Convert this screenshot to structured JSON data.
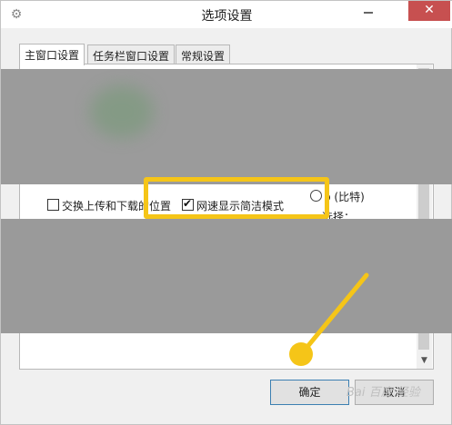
{
  "window": {
    "title": "选项设置",
    "close_glyph": "✕"
  },
  "tabs": [
    {
      "label": "主窗口设置",
      "active": true
    },
    {
      "label": "任务栏窗口设置",
      "active": false
    },
    {
      "label": "常规设置",
      "active": false
    }
  ],
  "options": {
    "swap_upload_download": {
      "label": "交换上传和下载的位置",
      "checked": false
    },
    "speed_simple_mode": {
      "label": "网速显示简洁模式",
      "checked": true
    }
  },
  "partial_texts": {
    "radio_fragment": "p (比特)",
    "select_fragment": "选择："
  },
  "buttons": {
    "ok": "确定",
    "cancel": "取消"
  },
  "watermark": "Bai 百度 经验",
  "colors": {
    "highlight": "#f5c518",
    "close_button": "#c75050"
  }
}
